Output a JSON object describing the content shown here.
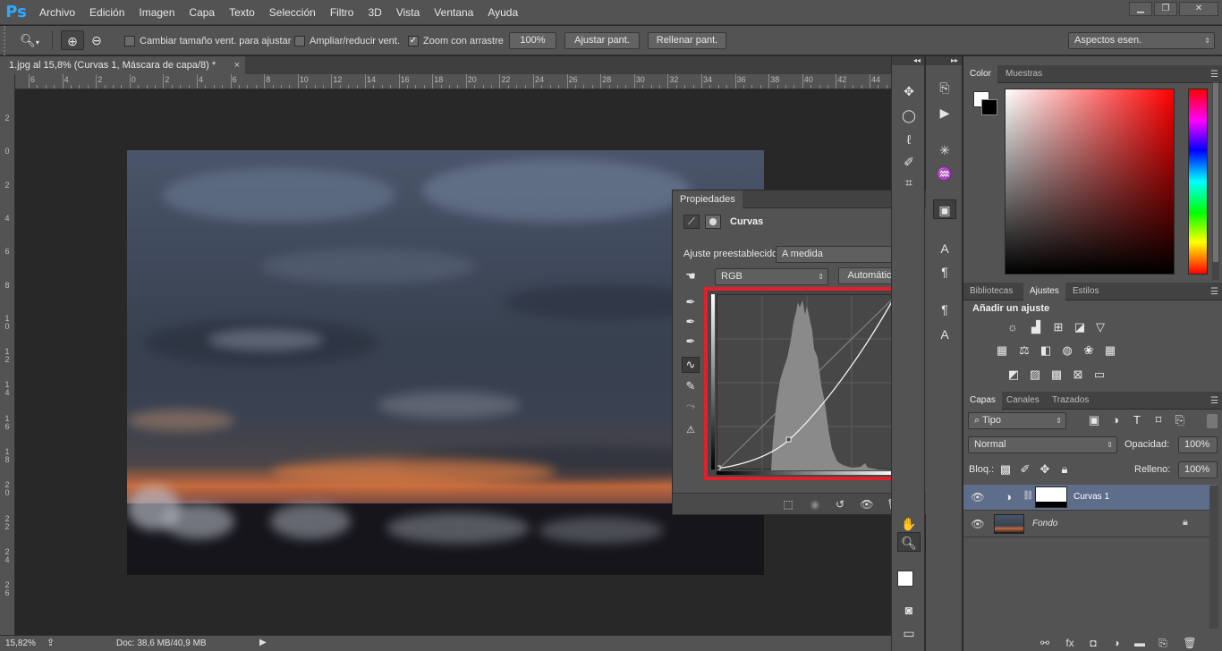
{
  "app": {
    "logo": "Ps"
  },
  "menu": [
    "Archivo",
    "Edición",
    "Imagen",
    "Capa",
    "Texto",
    "Selección",
    "Filtro",
    "3D",
    "Vista",
    "Ventana",
    "Ayuda"
  ],
  "window_controls": {
    "minimize": "▁",
    "restore": "❐",
    "close": "✕"
  },
  "options": {
    "resize_windows": "Cambiar tamaño vent. para ajustar",
    "zoom_all_windows": "Ampliar/reducir vent.",
    "scrubby_zoom": "Zoom con arrastre",
    "zoom_100": "100%",
    "fit_screen": "Ajustar pant.",
    "fill_screen": "Rellenar pant.",
    "workspace": "Aspectos esen."
  },
  "document": {
    "tab_title": "1.jpg al 15,8% (Curvas 1, Máscara de capa/8) *",
    "close": "×"
  },
  "ruler": {
    "top": [
      "6",
      "4",
      "2",
      "0",
      "2",
      "4",
      "6",
      "8",
      "10",
      "12",
      "14",
      "16",
      "18",
      "20",
      "22",
      "24",
      "26",
      "28",
      "30",
      "32",
      "34",
      "36",
      "38",
      "40",
      "42",
      "44"
    ],
    "left": [
      "2",
      "0",
      "2",
      "4",
      "6",
      "8",
      "1\n0",
      "1\n2",
      "1\n4",
      "1\n6",
      "1\n8",
      "2\n0",
      "2\n2",
      "2\n4",
      "2\n6"
    ]
  },
  "status": {
    "zoom": "15,82%",
    "doc_info": "Doc: 38,6 MB/40,9 MB"
  },
  "properties": {
    "tab": "Propiedades",
    "type": "Curvas",
    "preset_label": "Ajuste preestablecido:",
    "preset_value": "A medida",
    "channel": "RGB",
    "auto": "Automático"
  },
  "color_panel": {
    "tabs": [
      "Color",
      "Muestras"
    ],
    "foreground": "#ffffff",
    "background": "#000000"
  },
  "adjust_panel": {
    "tabs": [
      "Bibliotecas",
      "Ajustes",
      "Estilos"
    ],
    "title": "Añadir un ajuste"
  },
  "layers_panel": {
    "tabs": [
      "Capas",
      "Canales",
      "Trazados"
    ],
    "filter": "Tipo",
    "blend_mode": "Normal",
    "opacity_label": "Opacidad:",
    "opacity": "100%",
    "lock_label": "Bloq.:",
    "fill_label": "Relleno:",
    "fill": "100%",
    "layers": [
      {
        "name": "Curvas 1",
        "selected": true
      },
      {
        "name": "Fondo",
        "selected": false,
        "locked": true
      }
    ]
  },
  "colors": {
    "highlight": "#e0202a",
    "selected_layer": "#5d6d8a"
  }
}
